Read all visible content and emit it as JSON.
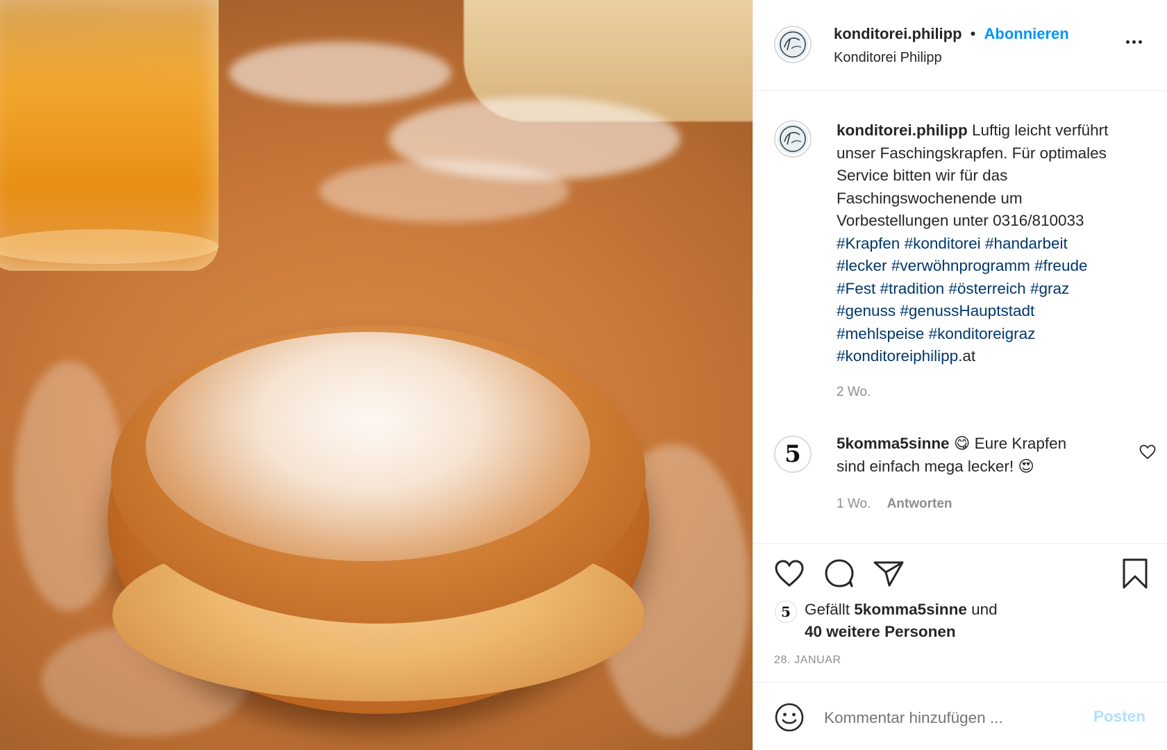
{
  "header": {
    "username": "konditorei.philipp",
    "separator": "•",
    "follow_label": "Abonnieren",
    "subtitle": "Konditorei Philipp",
    "more_icon": "more-horizontal-icon"
  },
  "caption": {
    "username": "konditorei.philipp",
    "text_lines": [
      "Luftig leicht verführt",
      "unser Faschingskrapfen. Für optimales",
      "Service bitten wir für das",
      "Faschingswochenende um",
      "Vorbestellungen unter 0316/810033"
    ],
    "hashtag_lines": [
      [
        "#Krapfen",
        "#konditorei",
        "#handarbeit"
      ],
      [
        "#lecker",
        "#verwöhnprogramm",
        "#freude"
      ],
      [
        "#Fest",
        "#tradition",
        "#österreich",
        "#graz"
      ],
      [
        "#genuss",
        "#genussHauptstadt"
      ],
      [
        "#mehlspeise",
        "#konditoreigraz"
      ]
    ],
    "last_tag": "#konditoreiphilipp",
    "last_tag_suffix": ".at",
    "time": "2 Wo."
  },
  "comment": {
    "username": "5komma5sinne",
    "emoji_1": "😋",
    "text_1": "Eure Krapfen",
    "text_2": "sind einfach mega lecker!",
    "emoji_2": "😍",
    "time": "1 Wo.",
    "reply_label": "Antworten",
    "avatar_glyph": "5"
  },
  "actions": {
    "icons": [
      "heart-icon",
      "comment-icon",
      "share-icon",
      "bookmark-icon"
    ]
  },
  "likes": {
    "prefix": "Gefällt",
    "user": "5komma5sinne",
    "connector": "und",
    "others": "40 weitere Personen"
  },
  "date": "28. JANUAR",
  "add_comment": {
    "placeholder": "Kommentar hinzufügen ...",
    "post_label": "Posten"
  },
  "colors": {
    "link_blue": "#0095f6",
    "hashtag_blue": "#00376b",
    "muted": "#8e8e8e",
    "post_disabled": "#b2dffc"
  }
}
